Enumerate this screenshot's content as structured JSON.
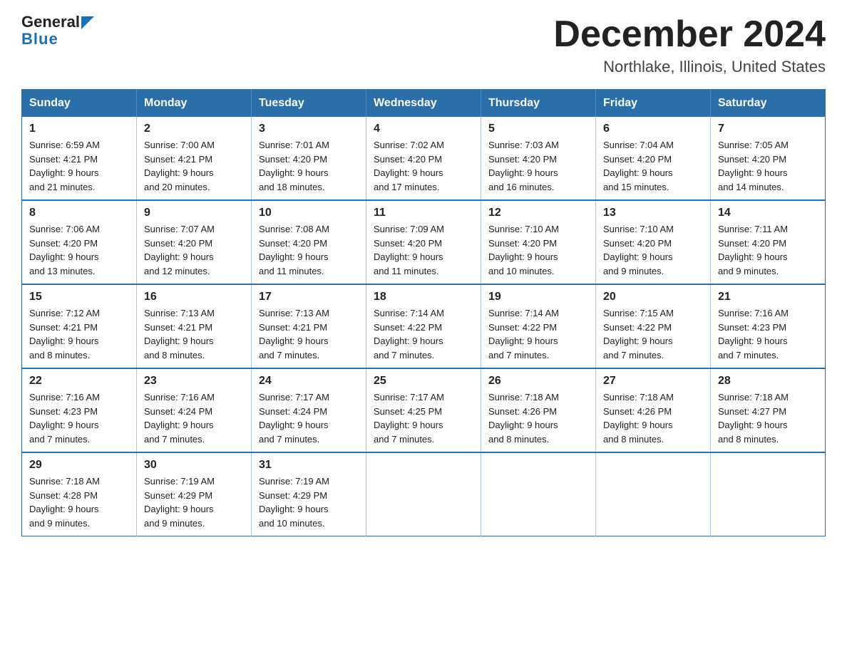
{
  "header": {
    "logo_line1": "General",
    "logo_line2": "Blue",
    "month_title": "December 2024",
    "location": "Northlake, Illinois, United States"
  },
  "weekdays": [
    "Sunday",
    "Monday",
    "Tuesday",
    "Wednesday",
    "Thursday",
    "Friday",
    "Saturday"
  ],
  "weeks": [
    [
      {
        "day": "1",
        "sunrise": "6:59 AM",
        "sunset": "4:21 PM",
        "daylight": "9 hours and 21 minutes."
      },
      {
        "day": "2",
        "sunrise": "7:00 AM",
        "sunset": "4:21 PM",
        "daylight": "9 hours and 20 minutes."
      },
      {
        "day": "3",
        "sunrise": "7:01 AM",
        "sunset": "4:20 PM",
        "daylight": "9 hours and 18 minutes."
      },
      {
        "day": "4",
        "sunrise": "7:02 AM",
        "sunset": "4:20 PM",
        "daylight": "9 hours and 17 minutes."
      },
      {
        "day": "5",
        "sunrise": "7:03 AM",
        "sunset": "4:20 PM",
        "daylight": "9 hours and 16 minutes."
      },
      {
        "day": "6",
        "sunrise": "7:04 AM",
        "sunset": "4:20 PM",
        "daylight": "9 hours and 15 minutes."
      },
      {
        "day": "7",
        "sunrise": "7:05 AM",
        "sunset": "4:20 PM",
        "daylight": "9 hours and 14 minutes."
      }
    ],
    [
      {
        "day": "8",
        "sunrise": "7:06 AM",
        "sunset": "4:20 PM",
        "daylight": "9 hours and 13 minutes."
      },
      {
        "day": "9",
        "sunrise": "7:07 AM",
        "sunset": "4:20 PM",
        "daylight": "9 hours and 12 minutes."
      },
      {
        "day": "10",
        "sunrise": "7:08 AM",
        "sunset": "4:20 PM",
        "daylight": "9 hours and 11 minutes."
      },
      {
        "day": "11",
        "sunrise": "7:09 AM",
        "sunset": "4:20 PM",
        "daylight": "9 hours and 11 minutes."
      },
      {
        "day": "12",
        "sunrise": "7:10 AM",
        "sunset": "4:20 PM",
        "daylight": "9 hours and 10 minutes."
      },
      {
        "day": "13",
        "sunrise": "7:10 AM",
        "sunset": "4:20 PM",
        "daylight": "9 hours and 9 minutes."
      },
      {
        "day": "14",
        "sunrise": "7:11 AM",
        "sunset": "4:20 PM",
        "daylight": "9 hours and 9 minutes."
      }
    ],
    [
      {
        "day": "15",
        "sunrise": "7:12 AM",
        "sunset": "4:21 PM",
        "daylight": "9 hours and 8 minutes."
      },
      {
        "day": "16",
        "sunrise": "7:13 AM",
        "sunset": "4:21 PM",
        "daylight": "9 hours and 8 minutes."
      },
      {
        "day": "17",
        "sunrise": "7:13 AM",
        "sunset": "4:21 PM",
        "daylight": "9 hours and 7 minutes."
      },
      {
        "day": "18",
        "sunrise": "7:14 AM",
        "sunset": "4:22 PM",
        "daylight": "9 hours and 7 minutes."
      },
      {
        "day": "19",
        "sunrise": "7:14 AM",
        "sunset": "4:22 PM",
        "daylight": "9 hours and 7 minutes."
      },
      {
        "day": "20",
        "sunrise": "7:15 AM",
        "sunset": "4:22 PM",
        "daylight": "9 hours and 7 minutes."
      },
      {
        "day": "21",
        "sunrise": "7:16 AM",
        "sunset": "4:23 PM",
        "daylight": "9 hours and 7 minutes."
      }
    ],
    [
      {
        "day": "22",
        "sunrise": "7:16 AM",
        "sunset": "4:23 PM",
        "daylight": "9 hours and 7 minutes."
      },
      {
        "day": "23",
        "sunrise": "7:16 AM",
        "sunset": "4:24 PM",
        "daylight": "9 hours and 7 minutes."
      },
      {
        "day": "24",
        "sunrise": "7:17 AM",
        "sunset": "4:24 PM",
        "daylight": "9 hours and 7 minutes."
      },
      {
        "day": "25",
        "sunrise": "7:17 AM",
        "sunset": "4:25 PM",
        "daylight": "9 hours and 7 minutes."
      },
      {
        "day": "26",
        "sunrise": "7:18 AM",
        "sunset": "4:26 PM",
        "daylight": "9 hours and 8 minutes."
      },
      {
        "day": "27",
        "sunrise": "7:18 AM",
        "sunset": "4:26 PM",
        "daylight": "9 hours and 8 minutes."
      },
      {
        "day": "28",
        "sunrise": "7:18 AM",
        "sunset": "4:27 PM",
        "daylight": "9 hours and 8 minutes."
      }
    ],
    [
      {
        "day": "29",
        "sunrise": "7:18 AM",
        "sunset": "4:28 PM",
        "daylight": "9 hours and 9 minutes."
      },
      {
        "day": "30",
        "sunrise": "7:19 AM",
        "sunset": "4:29 PM",
        "daylight": "9 hours and 9 minutes."
      },
      {
        "day": "31",
        "sunrise": "7:19 AM",
        "sunset": "4:29 PM",
        "daylight": "9 hours and 10 minutes."
      },
      null,
      null,
      null,
      null
    ]
  ],
  "labels": {
    "sunrise": "Sunrise:",
    "sunset": "Sunset:",
    "daylight": "Daylight:"
  }
}
